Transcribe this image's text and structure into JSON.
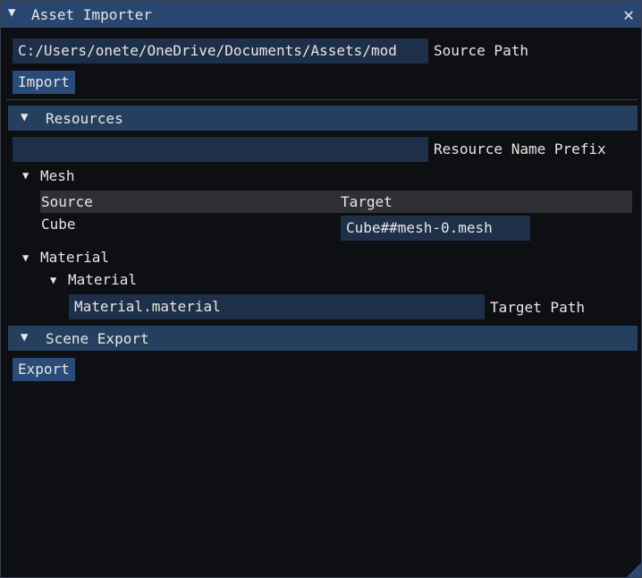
{
  "window": {
    "title": "Asset Importer",
    "close_glyph": "✕",
    "collapse_glyph": "▼"
  },
  "source": {
    "path_value": "C:/Users/onete/OneDrive/Documents/Assets/mod",
    "label": "Source Path"
  },
  "import_button": "Import",
  "resources": {
    "header": "Resources",
    "prefix_value": "",
    "prefix_label": "Resource Name Prefix",
    "mesh": {
      "header": "Mesh",
      "columns": [
        "Source",
        "Target"
      ],
      "rows": [
        {
          "source": "Cube",
          "target": "Cube##mesh-0.mesh"
        }
      ]
    },
    "material": {
      "header": "Material",
      "sub_header": "Material",
      "target_value": "Material.material",
      "target_label": "Target Path"
    }
  },
  "scene_export": {
    "header": "Scene Export",
    "button": "Export"
  },
  "icons": {
    "collapse": "triangle-down-icon",
    "close": "close-icon"
  },
  "colors": {
    "titlebar": "#28466f",
    "header": "#25405f",
    "field": "#1e3049",
    "button": "#2a4a78",
    "background": "#0d0f12"
  }
}
